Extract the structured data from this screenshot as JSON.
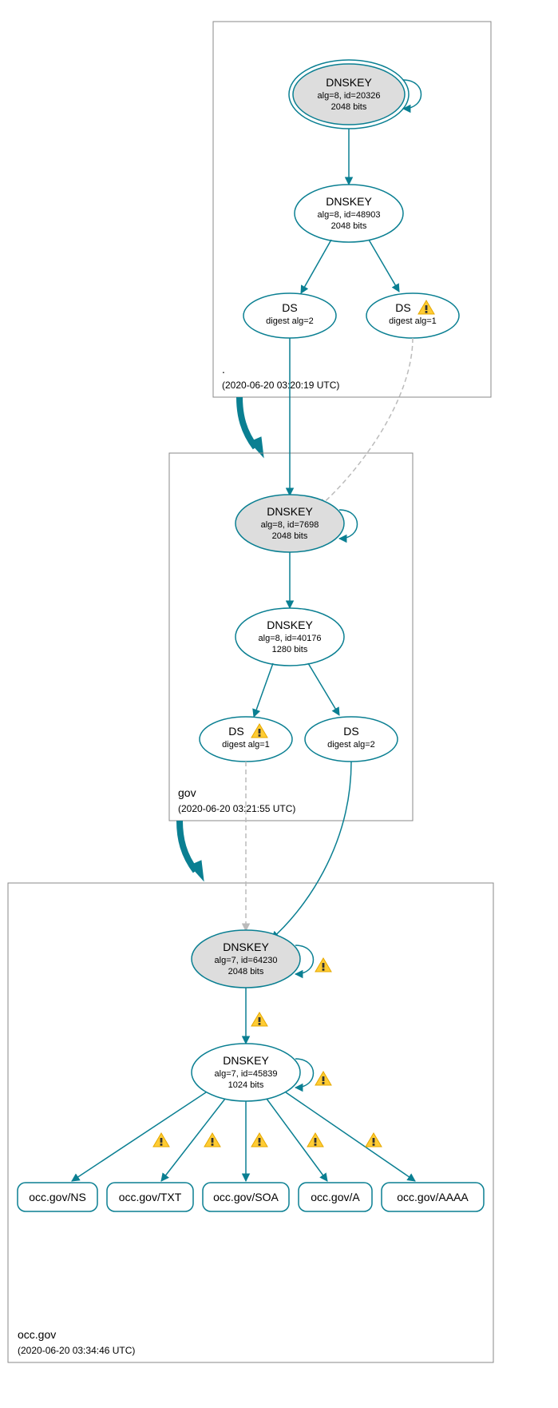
{
  "zones": {
    "root": {
      "label": ".",
      "timestamp": "(2020-06-20 03:20:19 UTC)"
    },
    "gov": {
      "label": "gov",
      "timestamp": "(2020-06-20 03:21:55 UTC)"
    },
    "occ": {
      "label": "occ.gov",
      "timestamp": "(2020-06-20 03:34:46 UTC)"
    }
  },
  "nodes": {
    "root_ksk": {
      "title": "DNSKEY",
      "line1": "alg=8, id=20326",
      "line2": "2048 bits"
    },
    "root_zsk": {
      "title": "DNSKEY",
      "line1": "alg=8, id=48903",
      "line2": "2048 bits"
    },
    "root_ds2": {
      "title": "DS",
      "line1": "digest alg=2"
    },
    "root_ds1": {
      "title": "DS",
      "line1": "digest alg=1"
    },
    "gov_ksk": {
      "title": "DNSKEY",
      "line1": "alg=8, id=7698",
      "line2": "2048 bits"
    },
    "gov_zsk": {
      "title": "DNSKEY",
      "line1": "alg=8, id=40176",
      "line2": "1280 bits"
    },
    "gov_ds1": {
      "title": "DS",
      "line1": "digest alg=1"
    },
    "gov_ds2": {
      "title": "DS",
      "line1": "digest alg=2"
    },
    "occ_ksk": {
      "title": "DNSKEY",
      "line1": "alg=7, id=64230",
      "line2": "2048 bits"
    },
    "occ_zsk": {
      "title": "DNSKEY",
      "line1": "alg=7, id=45839",
      "line2": "1024 bits"
    }
  },
  "rrsets": {
    "ns": "occ.gov/NS",
    "txt": "occ.gov/TXT",
    "soa": "occ.gov/SOA",
    "a": "occ.gov/A",
    "aaaa": "occ.gov/AAAA"
  },
  "chart_data": {
    "type": "dnssec-authentication-graph",
    "zones": [
      {
        "name": ".",
        "analyzed": "2020-06-20 03:20:19 UTC"
      },
      {
        "name": "gov",
        "analyzed": "2020-06-20 03:21:55 UTC"
      },
      {
        "name": "occ.gov",
        "analyzed": "2020-06-20 03:34:46 UTC"
      }
    ],
    "keys": [
      {
        "zone": ".",
        "role": "KSK",
        "alg": 8,
        "id": 20326,
        "bits": 2048,
        "trust_anchor": true,
        "self_sign": true
      },
      {
        "zone": ".",
        "role": "ZSK",
        "alg": 8,
        "id": 48903,
        "bits": 2048
      },
      {
        "zone": "gov",
        "role": "KSK",
        "alg": 8,
        "id": 7698,
        "bits": 2048,
        "self_sign": true
      },
      {
        "zone": "gov",
        "role": "ZSK",
        "alg": 8,
        "id": 40176,
        "bits": 1280
      },
      {
        "zone": "occ.gov",
        "role": "KSK",
        "alg": 7,
        "id": 64230,
        "bits": 2048,
        "self_sign": true,
        "warnings": true
      },
      {
        "zone": "occ.gov",
        "role": "ZSK",
        "alg": 7,
        "id": 45839,
        "bits": 1024,
        "self_sign": true,
        "warnings": true
      }
    ],
    "ds": [
      {
        "parent": ".",
        "child": "gov",
        "digest_alg": 2,
        "status": "secure"
      },
      {
        "parent": ".",
        "child": "gov",
        "digest_alg": 1,
        "status": "warning"
      },
      {
        "parent": "gov",
        "child": "occ.gov",
        "digest_alg": 1,
        "status": "warning"
      },
      {
        "parent": "gov",
        "child": "occ.gov",
        "digest_alg": 2,
        "status": "secure"
      }
    ],
    "rrsets": [
      {
        "name": "occ.gov",
        "type": "NS",
        "signed_by": 45839,
        "warnings": true
      },
      {
        "name": "occ.gov",
        "type": "TXT",
        "signed_by": 45839,
        "warnings": true
      },
      {
        "name": "occ.gov",
        "type": "SOA",
        "signed_by": 45839,
        "warnings": true
      },
      {
        "name": "occ.gov",
        "type": "A",
        "signed_by": 45839,
        "warnings": true
      },
      {
        "name": "occ.gov",
        "type": "AAAA",
        "signed_by": 45839,
        "warnings": true
      }
    ]
  }
}
